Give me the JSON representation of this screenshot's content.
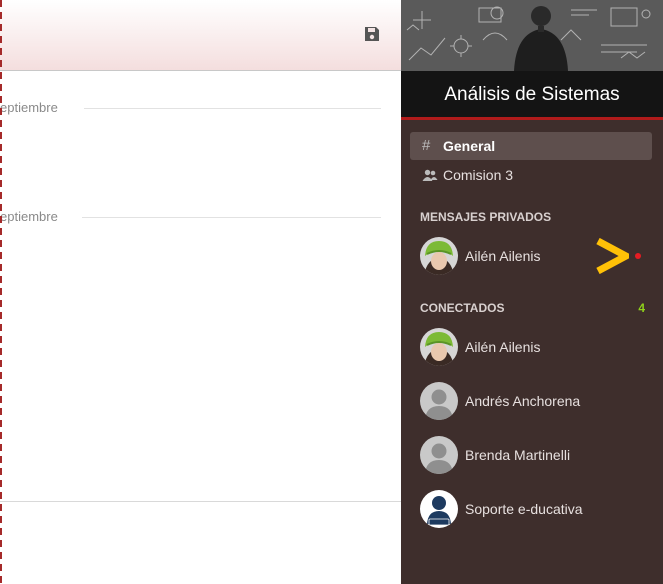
{
  "chat": {
    "date_separators": [
      "eptiembre",
      "eptiembre"
    ]
  },
  "sidebar": {
    "course_title": "Análisis de Sistemas",
    "channels": [
      {
        "label": "General",
        "icon": "hash-icon",
        "active": true
      },
      {
        "label": "Comision 3",
        "icon": "group-icon",
        "active": false
      }
    ],
    "private_messages": {
      "heading": "MENSAJES PRIVADOS",
      "users": [
        {
          "name": "Ailén Ailenis",
          "avatar": "green-hat-avatar",
          "unread": true
        }
      ]
    },
    "connected": {
      "heading": "CONECTADOS",
      "count": "4",
      "users": [
        {
          "name": "Ailén Ailenis",
          "avatar": "green-hat-avatar"
        },
        {
          "name": "Andrés Anchorena",
          "avatar": "default-avatar"
        },
        {
          "name": "Brenda Martinelli",
          "avatar": "default-avatar"
        },
        {
          "name": "Soporte e-ducativa",
          "avatar": "admin-avatar"
        }
      ]
    }
  },
  "colors": {
    "sidebar_bg": "#3e2e2c",
    "title_bar_bg": "#141414",
    "title_underline": "#b11b1b",
    "active_channel_bg": "#5e4f4d",
    "connected_count": "#8fd11b",
    "unread_dot": "#e51c23",
    "pointer_arrow": "#ffc107"
  }
}
